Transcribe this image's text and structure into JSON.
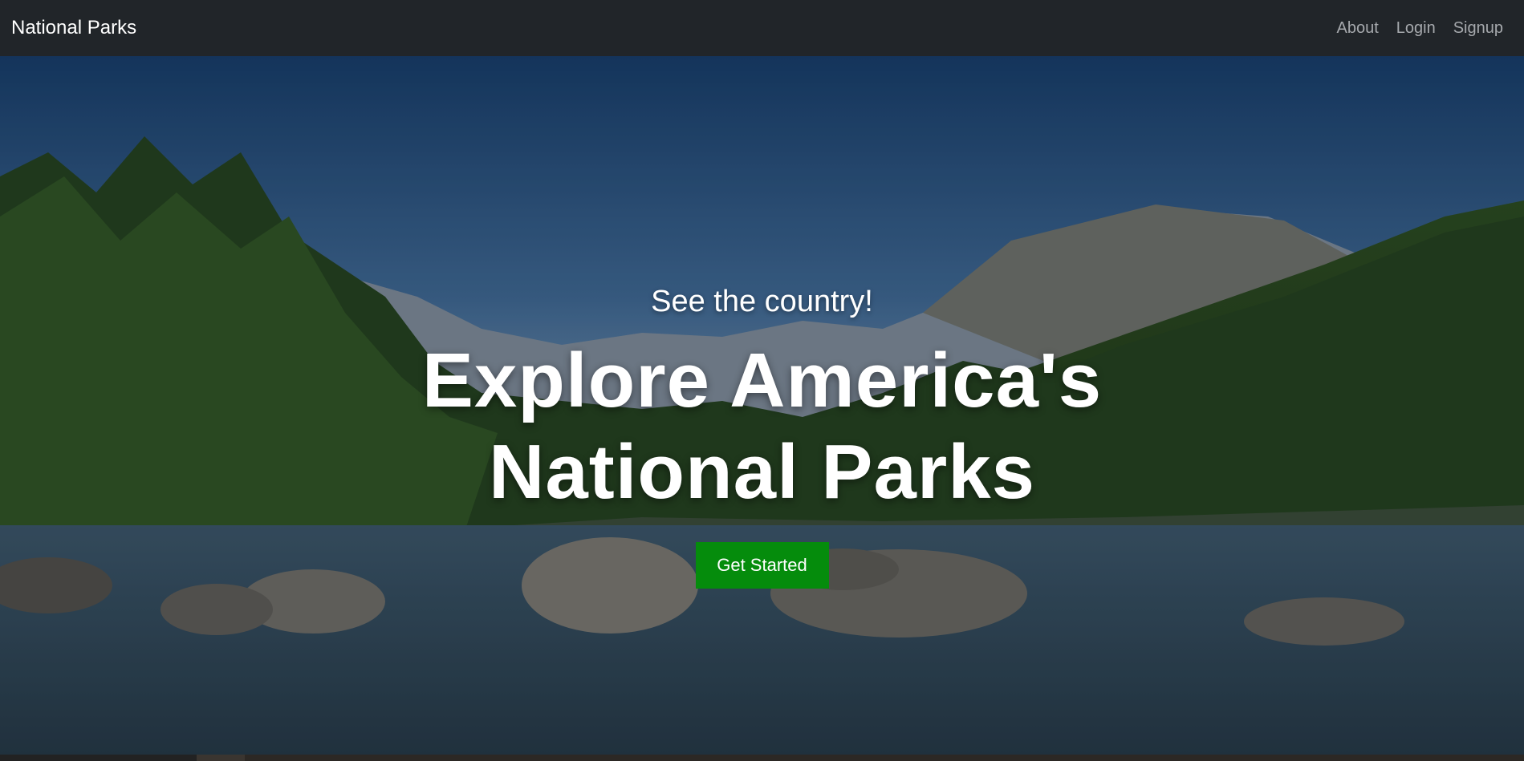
{
  "navbar": {
    "brand": "National Parks",
    "links": [
      {
        "label": "About"
      },
      {
        "label": "Login"
      },
      {
        "label": "Signup"
      }
    ]
  },
  "hero": {
    "subtitle": "See the country!",
    "title_line1": "Explore America's",
    "title_line2": "National Parks",
    "cta_label": "Get Started"
  },
  "colors": {
    "navbar_bg": "#212529",
    "cta_bg": "#058c0c",
    "nav_link": "#a6a9ad"
  }
}
